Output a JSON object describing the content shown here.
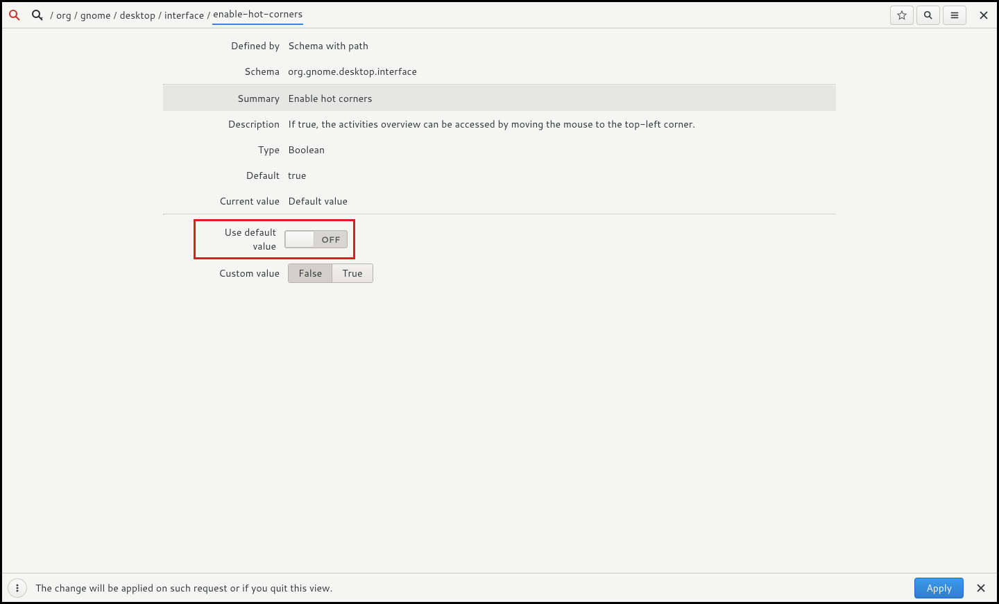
{
  "breadcrumb": {
    "segments": [
      "org",
      "gnome",
      "desktop",
      "interface",
      "enable-hot-corners"
    ]
  },
  "details": {
    "defined_by_label": "Defined by",
    "defined_by_value": "Schema with path",
    "schema_label": "Schema",
    "schema_value": "org.gnome.desktop.interface",
    "summary_label": "Summary",
    "summary_value": "Enable hot corners",
    "description_label": "Description",
    "description_value": "If true, the activities overview can be accessed by moving the mouse to the top-left corner.",
    "type_label": "Type",
    "type_value": "Boolean",
    "default_label": "Default",
    "default_value": "true",
    "current_value_label": "Current value",
    "current_value_value": "Default value",
    "use_default_label": "Use default value",
    "use_default_state": "OFF",
    "custom_value_label": "Custom value",
    "custom_false": "False",
    "custom_true": "True"
  },
  "footer": {
    "message": "The change will be applied on such request or if you quit this view.",
    "apply_label": "Apply"
  }
}
